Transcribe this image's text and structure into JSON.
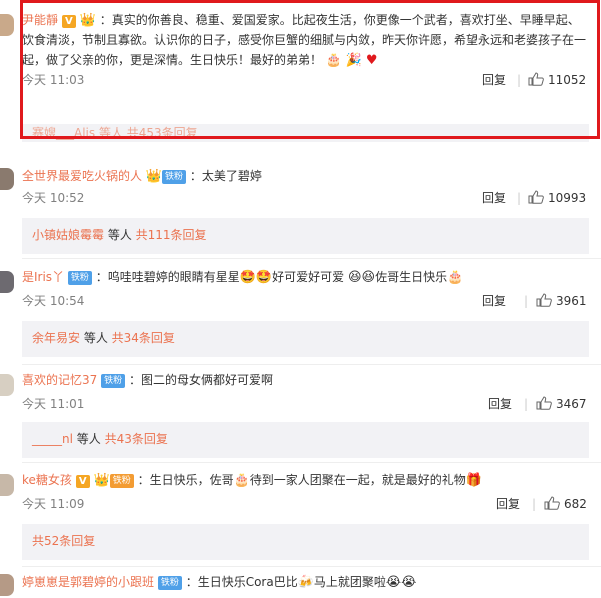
{
  "comments": [
    {
      "username": "尹能靜",
      "text": "：真实的你善良、稳重、爱国爱家。比起夜生活，你更像一个武者，喜欢打坐、早睡早起、饮食清淡，节制且寡欲。认识你的日子，感受你巨蟹的细腻与内敛，昨天你许愿，希望永远和老婆孩子在一起，做了父亲的你，更是深情。生日快乐！最好的弟弟！",
      "time": "今天 11:03",
      "reply_label": "回复",
      "likes": "11052",
      "sub_text": "赛嫂___Alis 等人 共453条回复"
    },
    {
      "username": "全世界最爱吃火锅的人",
      "badge": "铁粉",
      "text": "：太美了碧婷",
      "time": "今天 10:52",
      "reply_label": "回复",
      "likes": "10993",
      "sub_who": "小镇姑娘霉霉",
      "sub_mid": " 等人 ",
      "sub_cnt": "共111条回复"
    },
    {
      "username": "是Iris丫",
      "badge": "铁粉",
      "text_a": "：呜哇哇碧婷的眼睛有星星",
      "text_b": "好可爱好可爱",
      "text_c": "佐哥生日快乐",
      "time": "今天 10:54",
      "reply_label": "回复",
      "likes": "3961",
      "sub_who": "余年易安",
      "sub_mid": " 等人 ",
      "sub_cnt": "共34条回复"
    },
    {
      "username": "喜欢的记忆37",
      "badge": "铁粉",
      "text": "：图二的母女俩都好可爱啊",
      "time": "今天 11:01",
      "reply_label": "回复",
      "likes": "3467",
      "sub_who": "_____nl",
      "sub_mid": " 等人 ",
      "sub_cnt": "共43条回复"
    },
    {
      "username": "ke糖女孩",
      "badge": "铁粉",
      "text_a": "：生日快乐，佐哥",
      "text_b": "待到一家人团聚在一起，就是最好的礼物",
      "time": "今天 11:09",
      "reply_label": "回复",
      "likes": "682",
      "sub_cnt": "共52条回复"
    },
    {
      "username": "婷崽崽是郭碧婷的小跟班",
      "badge": "铁粉",
      "text_a": "：生日快乐Cora巴比",
      "text_b": "马上就团聚啦"
    }
  ],
  "colors": {
    "username": "#eb7350",
    "highlight": "#e0191d",
    "badge_fan": "#4fa0e8"
  }
}
